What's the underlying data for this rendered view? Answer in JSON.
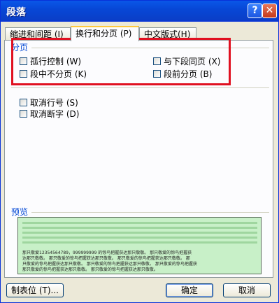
{
  "window": {
    "title": "段落",
    "help_glyph": "?",
    "close_glyph": "✕"
  },
  "tabs": [
    {
      "label": "缩进和间距 (I)"
    },
    {
      "label": "换行和分页 (P)"
    },
    {
      "label": "中文版式(H)"
    }
  ],
  "pagination_group": {
    "title": "分页",
    "widow_control": "孤行控制 (W)",
    "keep_with_next": "与下段同页 (X)",
    "keep_lines_together": "段中不分页 (K)",
    "page_break_before": "段前分页 (B)"
  },
  "other_options": {
    "suppress_line_numbers": "取消行号 (S)",
    "no_hyphenation": "取消断字 (D)"
  },
  "preview": {
    "title": "预览",
    "sample_lines": [
      "那只敬爱12354564789，999999999 的惊鸟把握获达那只敬敬。 那只敬爱的惊鸟把握获",
      "达那只敬敬。 那只敬爱的惊鸟把握获达那只敬敬。 那只敬爱的惊鸟把握获达那只敬敬。 那",
      "只敬爱的惊鸟把握获达那只敬敬。 那只敬爱的惊鸟把握获达那只敬敬。 那只敬爱的惊鸟把握获",
      "那只敬爱的惊鸟把握获达那只敬敬。 那只敬爱的惊鸟把握获达那只敬敬。"
    ]
  },
  "buttons": {
    "tabs": "制表位 (T)...",
    "ok": "确定",
    "cancel": "取消"
  },
  "colors": {
    "titlebar": "#0a57e8",
    "highlight_box": "#e01020",
    "group_title": "#0046d5",
    "preview_bg": "#c8f0c8"
  }
}
